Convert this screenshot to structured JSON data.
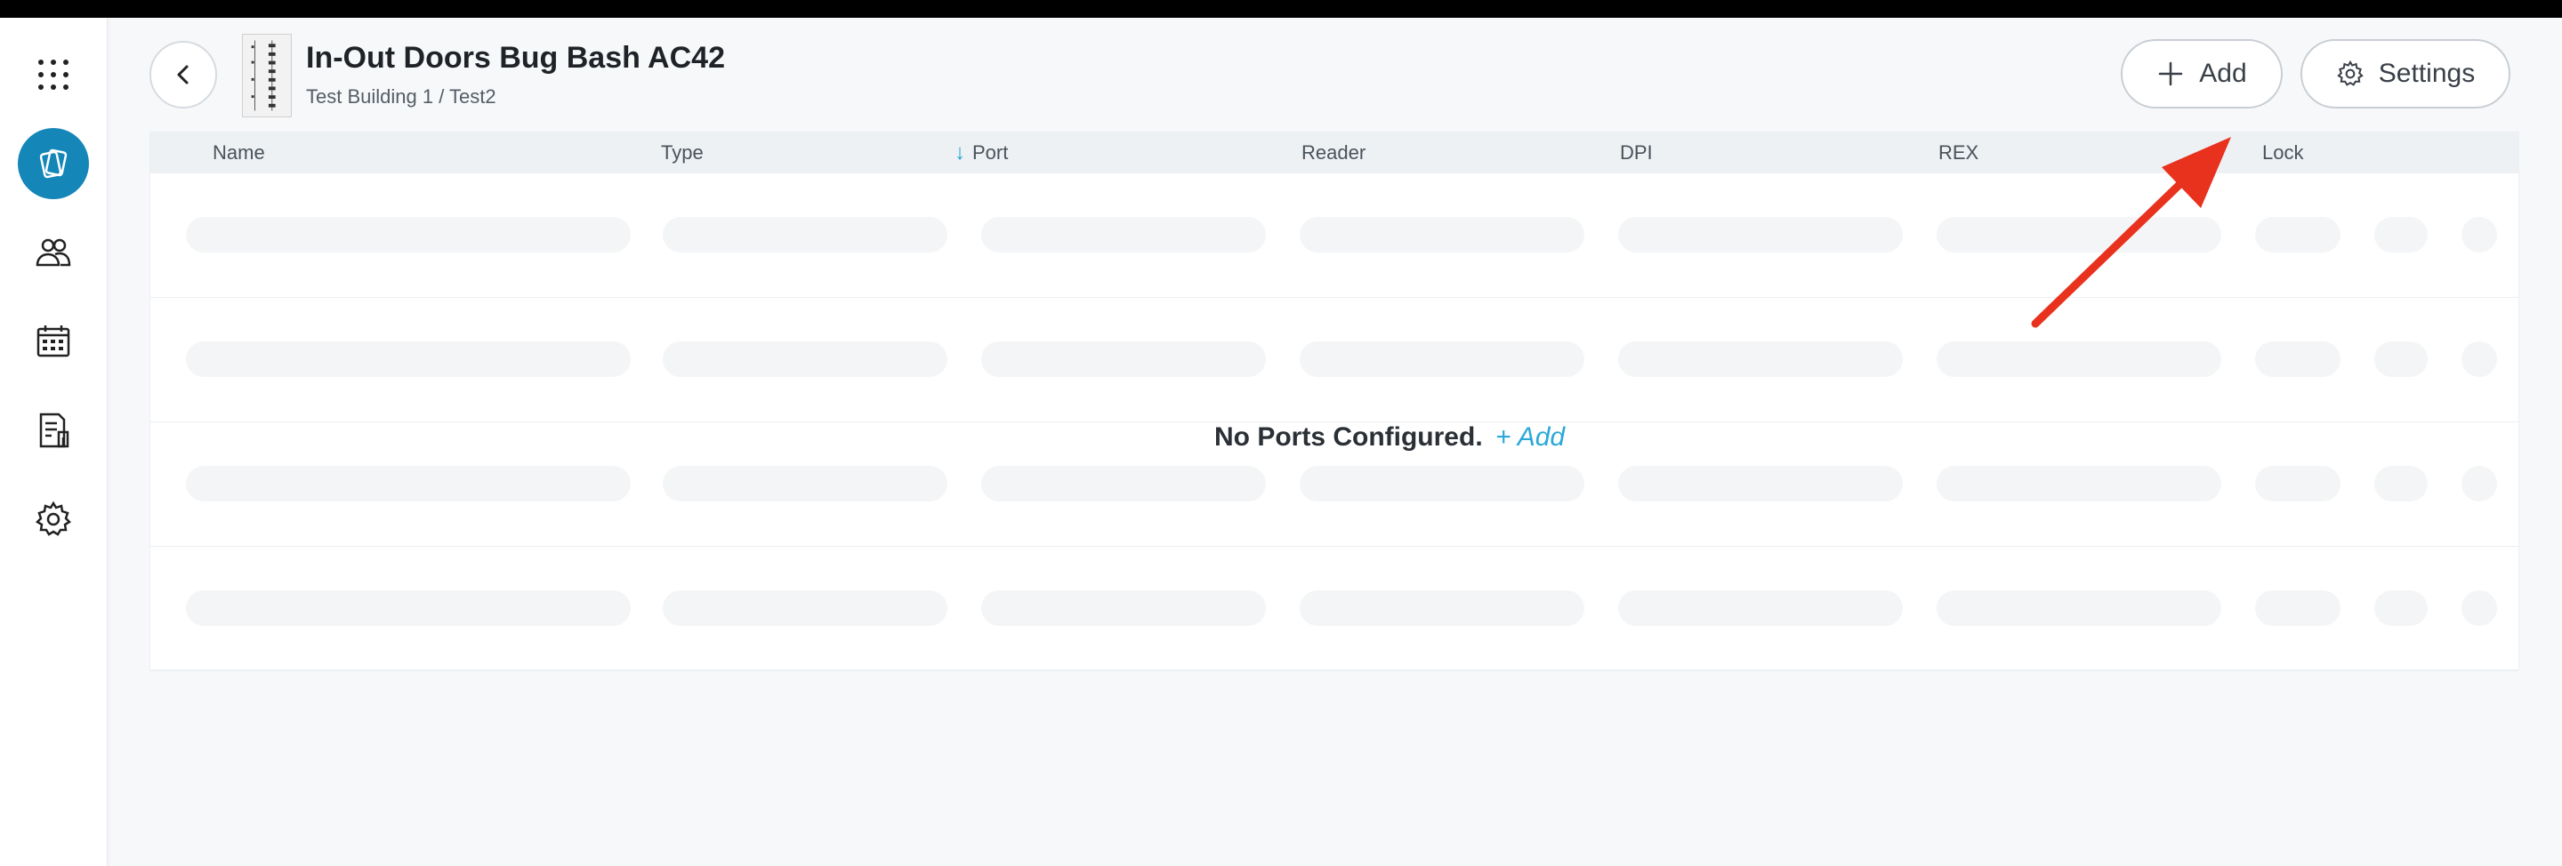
{
  "header": {
    "title": "In-Out Doors Bug Bash AC42",
    "breadcrumb": "Test Building 1 / Test2",
    "add_label": "Add",
    "settings_label": "Settings"
  },
  "sidebar": {
    "items": [
      {
        "name": "apps-grid-icon"
      },
      {
        "name": "access-cards-icon",
        "active": true
      },
      {
        "name": "users-icon"
      },
      {
        "name": "calendar-icon"
      },
      {
        "name": "reports-icon"
      },
      {
        "name": "settings-gear-icon"
      }
    ]
  },
  "table": {
    "columns": [
      "Name",
      "Type",
      "Port",
      "Reader",
      "DPI",
      "REX",
      "Lock"
    ],
    "sorted_column": "Port",
    "empty_text": "No Ports Configured.",
    "empty_add_text": "+ Add",
    "skeleton_rows": 4
  },
  "colors": {
    "accent": "#1486b8",
    "link": "#2aa8d8",
    "annotation_arrow": "#e8321e"
  }
}
